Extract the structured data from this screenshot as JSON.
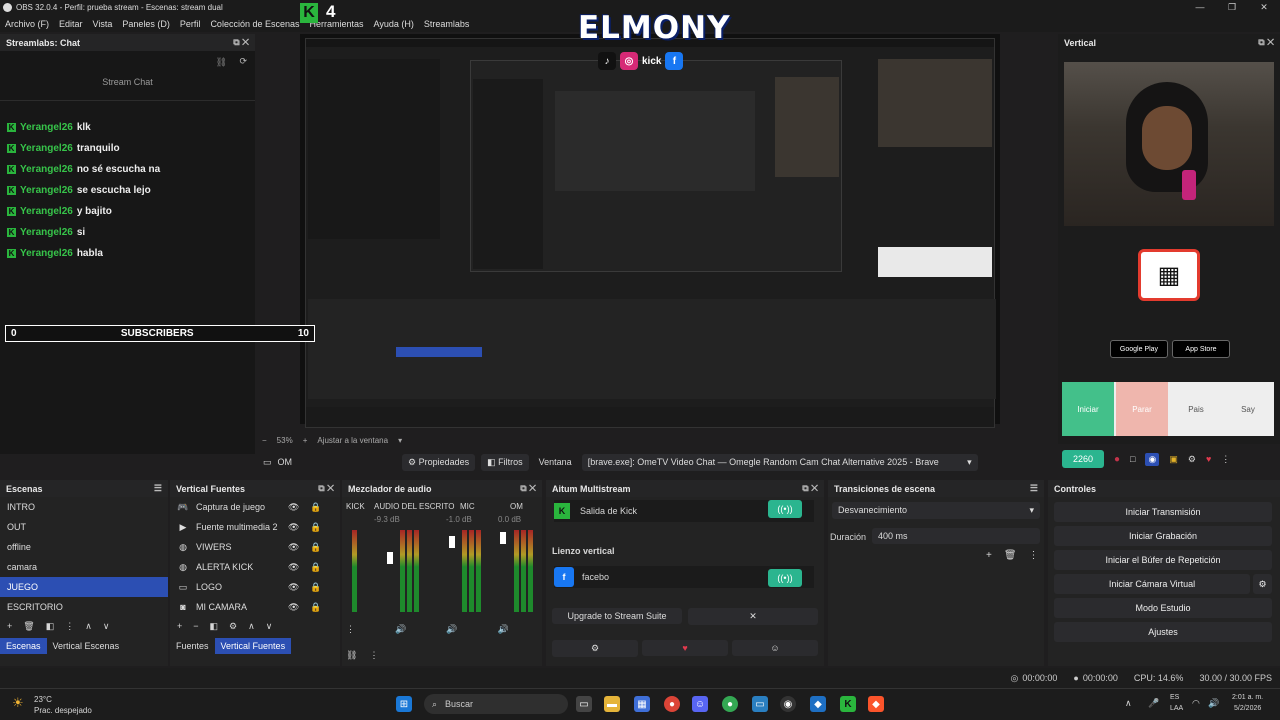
{
  "window": {
    "title": "OBS 32.0.4 - Perfil: prueba stream - Escenas: stream dual"
  },
  "menu": [
    "Archivo (F)",
    "Editar",
    "Vista",
    "Paneles (D)",
    "Perfil",
    "Colección de Escenas",
    "Herramientas",
    "Ayuda (H)",
    "Streamlabs"
  ],
  "overlay": {
    "kick_count": "4",
    "brand": "ELMONY",
    "kick_text": "kick"
  },
  "chat": {
    "title": "Streamlabs: Chat",
    "header": "Stream Chat",
    "messages": [
      {
        "user": "Yerangel26",
        "text": "klk"
      },
      {
        "user": "Yerangel26",
        "text": "tranquilo"
      },
      {
        "user": "Yerangel26",
        "text": "no sé escucha na"
      },
      {
        "user": "Yerangel26",
        "text": "se escucha lejo"
      },
      {
        "user": "Yerangel26",
        "text": "y bajito"
      },
      {
        "user": "Yerangel26",
        "text": "si"
      },
      {
        "user": "Yerangel26",
        "text": "habla"
      }
    ]
  },
  "subscribers": {
    "start": "0",
    "label": "SUBSCRIBERS",
    "goal": "10"
  },
  "vertical": {
    "title": "Vertical",
    "tiles": [
      "Iniciar",
      "Parar",
      "Pais",
      "Say"
    ],
    "stores": [
      "Google Play",
      "App Store"
    ]
  },
  "preview_zoom": {
    "zoom": "53%",
    "fit": "Ajustar a la ventana"
  },
  "scene_toolbar": {
    "om": "OM",
    "properties": "Propiedades",
    "filters": "Filtros",
    "window_label": "Ventana",
    "window_value": "[brave.exe]: OmeTV Video Chat — Omegle Random Cam Chat Alternative 2025 - Brave"
  },
  "vertical_toolbar": {
    "badge": "2260"
  },
  "scenes": {
    "title": "Escenas",
    "items": [
      "INTRO",
      "OUT",
      "offline",
      "camara",
      "JUEGO",
      "ESCRITORIO"
    ],
    "selected": 4,
    "tabs": [
      "Escenas",
      "Vertical Escenas"
    ]
  },
  "sources": {
    "title": "Vertical Fuentes",
    "items": [
      "Captura de juego",
      "Fuente multimedia 2",
      "VIWERS",
      "ALERTA KICK",
      "LOGO",
      "MI CAMARA"
    ],
    "tabs": [
      "Fuentes",
      "Vertical Fuentes"
    ]
  },
  "mixer": {
    "title": "Mezclador de audio",
    "channels": [
      {
        "name": "KICK",
        "db": ""
      },
      {
        "name": "AUDIO DEL ESCRITO",
        "db": "-9.3 dB"
      },
      {
        "name": "MIC",
        "db": "-1.0 dB"
      },
      {
        "name": "OM",
        "db": "0.0 dB"
      }
    ]
  },
  "multistream": {
    "title": "Aitum Multistream",
    "kick_output": "Salida de Kick",
    "vertical_canvas": "Lienzo vertical",
    "facebook": "facebo",
    "upgrade": "Upgrade to Stream Suite"
  },
  "transitions": {
    "title": "Transiciones de escena",
    "transition": "Desvanecimiento",
    "duration_label": "Duración",
    "duration": "400 ms"
  },
  "controls": {
    "title": "Controles",
    "buttons": [
      "Iniciar Transmisión",
      "Iniciar Grabación",
      "Iniciar el Búfer de Repetición",
      "Iniciar Cámara Virtual",
      "Modo Estudio",
      "Ajustes"
    ]
  },
  "status": {
    "stream_time": "00:00:00",
    "rec_time": "00:00:00",
    "cpu": "CPU: 14.6%",
    "fps": "30.00 / 30.00 FPS"
  },
  "taskbar": {
    "temp": "23°C",
    "weather": "Prac. despejado",
    "search": "Buscar",
    "lang": "ES",
    "lang2": "LAA",
    "time": "2:01 a. m.",
    "date": "5/2/2026"
  },
  "colors": {
    "accent": "#2c4fb3",
    "kick": "#2ab53d",
    "stream_green": "#2bb58f"
  }
}
